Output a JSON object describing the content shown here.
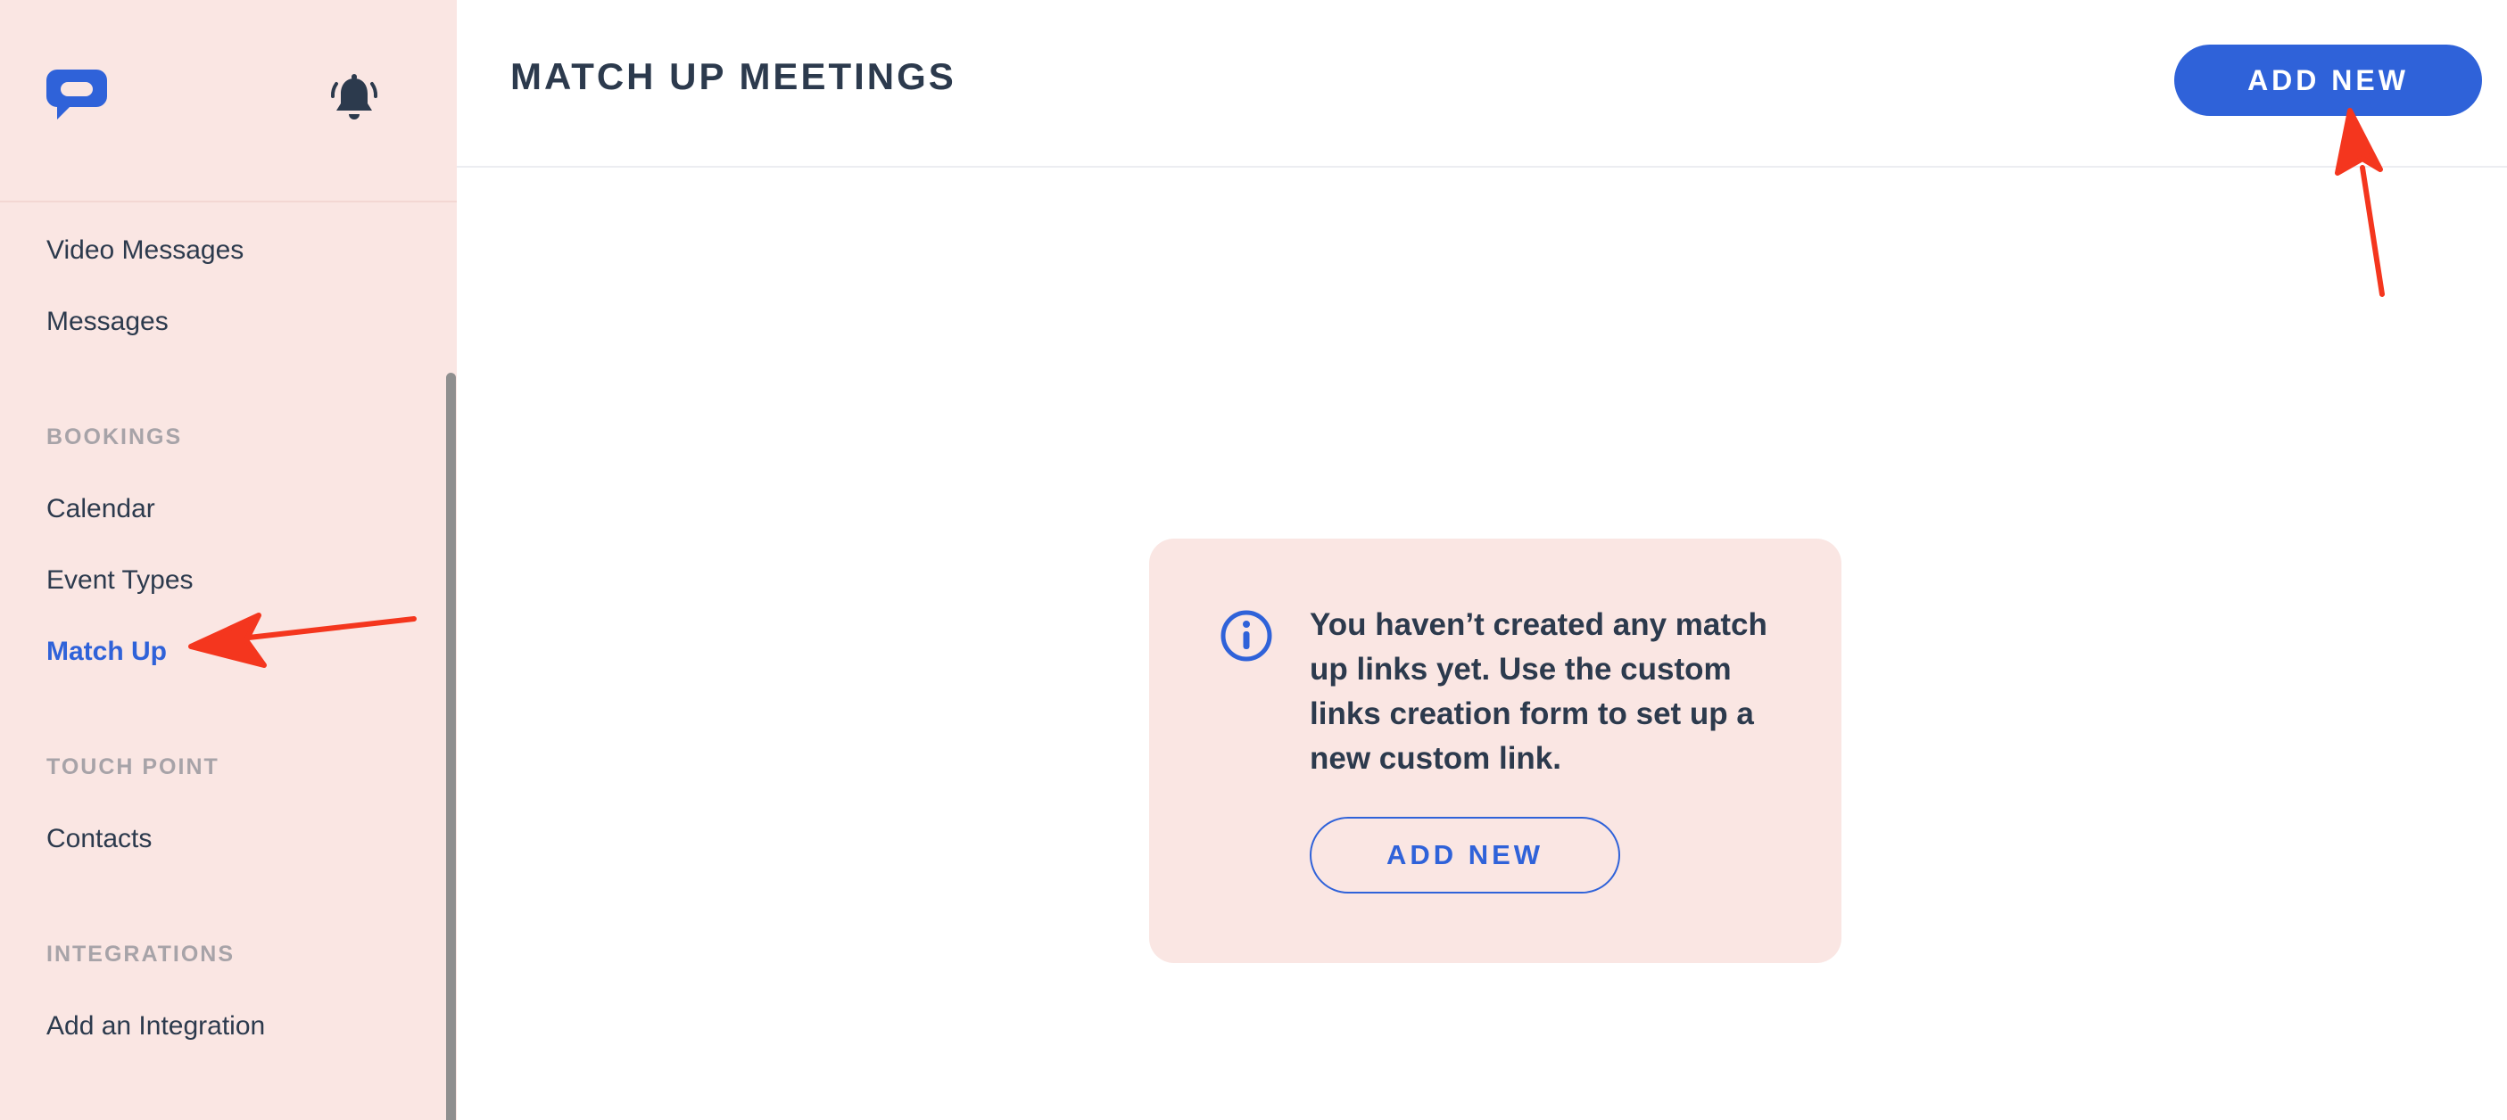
{
  "sidebar": {
    "logo_icon": "chat-bubble-logo-icon",
    "bell_icon": "bell-icon",
    "items_top": [
      {
        "label": "Video Messages"
      },
      {
        "label": "Messages"
      }
    ],
    "sections": [
      {
        "label": "BOOKINGS",
        "items": [
          {
            "label": "Calendar"
          },
          {
            "label": "Event Types"
          },
          {
            "label": "Match Up",
            "active": true
          }
        ]
      },
      {
        "label": "TOUCH POINT",
        "items": [
          {
            "label": "Contacts"
          }
        ]
      },
      {
        "label": "INTEGRATIONS",
        "items": [
          {
            "label": "Add an Integration"
          }
        ]
      }
    ]
  },
  "header": {
    "title": "MATCH UP MEETINGS",
    "add_new_label": "ADD NEW"
  },
  "empty_state": {
    "icon": "info-icon",
    "message": "You haven’t created any match up links yet. Use the custom links creation form to set up a new custom link.",
    "add_new_label": "ADD NEW"
  },
  "colors": {
    "accent": "#2f62d9",
    "sidebar_bg": "#fae6e3",
    "text": "#2c3a4d",
    "section_label": "#a7a3a8",
    "annotation_arrow": "#f4361e"
  }
}
